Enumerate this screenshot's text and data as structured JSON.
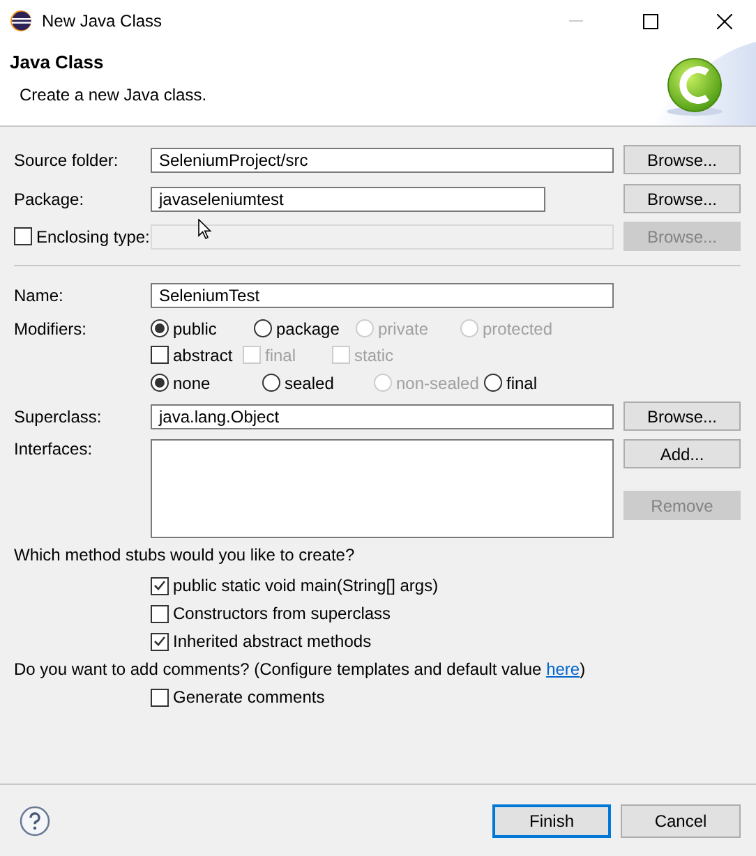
{
  "window": {
    "title": "New Java Class"
  },
  "header": {
    "title": "Java Class",
    "description": "Create a new Java class."
  },
  "source_folder": {
    "label": "Source folder:",
    "value": "SeleniumProject/src",
    "button": {
      "label": "Browse...",
      "disabled": false
    }
  },
  "package": {
    "label": "Package:",
    "value": "javaseleniumtest",
    "button": {
      "label": "Browse...",
      "disabled": false
    }
  },
  "enclosing_type": {
    "label": "Enclosing type:",
    "checked": false,
    "disabled": true,
    "button": {
      "label": "Browse...",
      "disabled": true
    }
  },
  "name": {
    "label": "Name:",
    "value": "SeleniumTest"
  },
  "modifiers": {
    "label": "Modifiers:",
    "access": [
      {
        "label": "public",
        "selected": true,
        "disabled": false
      },
      {
        "label": "package",
        "selected": false,
        "disabled": false
      },
      {
        "label": "private",
        "selected": false,
        "disabled": true
      },
      {
        "label": "protected",
        "selected": false,
        "disabled": true
      }
    ],
    "flags": [
      {
        "label": "abstract",
        "checked": false,
        "disabled": false
      },
      {
        "label": "final",
        "checked": false,
        "disabled": true
      },
      {
        "label": "static",
        "checked": false,
        "disabled": true
      }
    ],
    "sealing": [
      {
        "label": "none",
        "selected": true,
        "disabled": false
      },
      {
        "label": "sealed",
        "selected": false,
        "disabled": false
      },
      {
        "label": "non-sealed",
        "selected": false,
        "disabled": true
      },
      {
        "label": "final",
        "selected": false,
        "disabled": false
      }
    ]
  },
  "superclass": {
    "label": "Superclass:",
    "value": "java.lang.Object",
    "button": {
      "label": "Browse...",
      "disabled": false
    }
  },
  "interfaces": {
    "label": "Interfaces:",
    "buttons": [
      {
        "label": "Add...",
        "disabled": false
      },
      {
        "label": "Remove",
        "disabled": true
      }
    ]
  },
  "stubs": {
    "question": "Which method stubs would you like to create?",
    "options": [
      {
        "label": "public static void main(String[] args)",
        "checked": true
      },
      {
        "label": "Constructors from superclass",
        "checked": false
      },
      {
        "label": "Inherited abstract methods",
        "checked": true
      }
    ]
  },
  "comments": {
    "question": "Do you want to add comments? (Configure templates and default value",
    "link": "here",
    "after": ")",
    "options": [
      {
        "label": "Generate comments",
        "checked": false
      }
    ]
  },
  "footer": {
    "buttons": [
      {
        "label": "Finish",
        "default": true
      },
      {
        "label": "Cancel",
        "default": false
      }
    ]
  }
}
